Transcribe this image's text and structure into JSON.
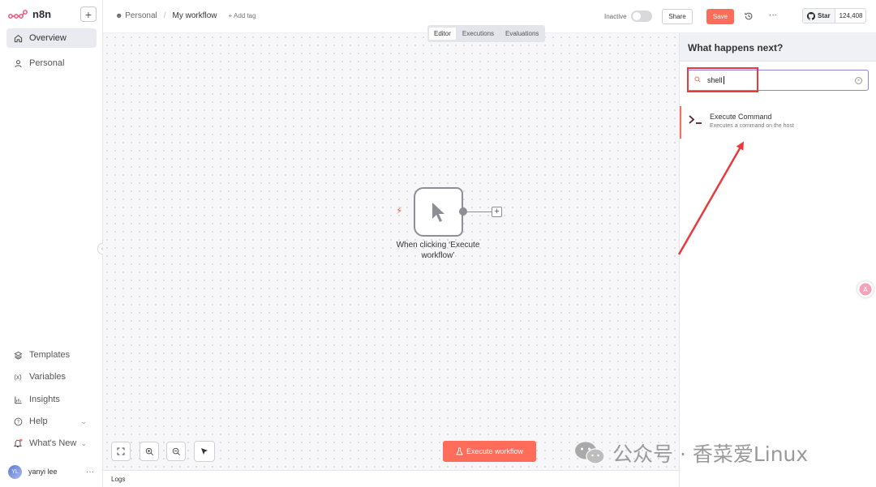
{
  "app": {
    "logo_text": "n8n"
  },
  "sidebar": {
    "add_label": "+",
    "top_items": [
      {
        "label": "Overview",
        "icon": "home-icon",
        "active": true
      },
      {
        "label": "Personal",
        "icon": "user-icon",
        "active": false
      }
    ],
    "bottom_items": [
      {
        "label": "Templates",
        "icon": "templates-icon"
      },
      {
        "label": "Variables",
        "icon": "variables-icon"
      },
      {
        "label": "Insights",
        "icon": "insights-icon"
      },
      {
        "label": "Help",
        "icon": "help-icon"
      },
      {
        "label": "What's New",
        "icon": "bell-icon"
      }
    ],
    "user": {
      "initials": "YL",
      "name": "yanyi lee",
      "more": "···"
    }
  },
  "header": {
    "breadcrumb_project": "Personal",
    "breadcrumb_sep": "/",
    "workflow_name": "My workflow",
    "add_tag": "+ Add tag",
    "status_label": "Inactive",
    "share_label": "Share",
    "save_label": "Save",
    "more_label": "···",
    "github_star": "Star",
    "github_count": "124,408"
  },
  "canvas": {
    "tabs": [
      "Editor",
      "Executions",
      "Evaluations"
    ],
    "active_tab": "Editor",
    "node_label": "When clicking ‘Execute workflow’",
    "execute_label": "Execute workflow",
    "logs_label": "Logs"
  },
  "panel": {
    "title": "What happens next?",
    "search_value": "shell",
    "results": [
      {
        "title": "Execute Command",
        "description": "Executes a command on the host"
      }
    ]
  },
  "watermark": {
    "text": "公众号 · 香菜爱Linux"
  },
  "colors": {
    "accent": "#ff6d5a",
    "highlight": "#e83a3a",
    "search_border": "#8f86d8"
  }
}
